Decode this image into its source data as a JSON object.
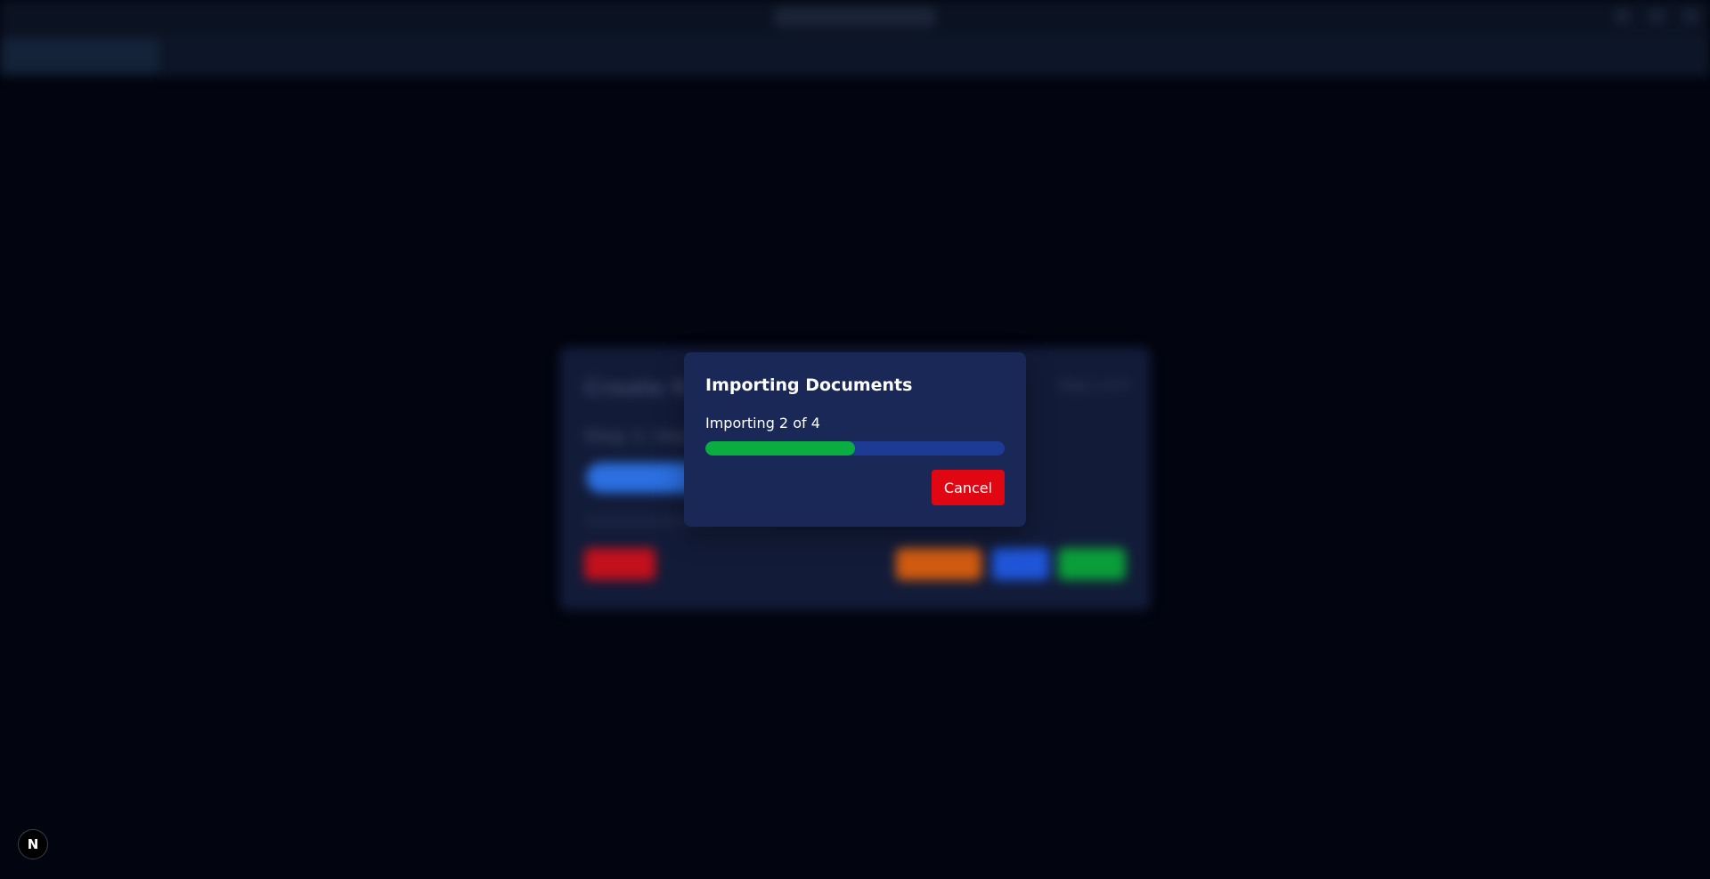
{
  "background": {
    "topbar": {
      "title": ""
    },
    "subbar": {
      "active_tab": ""
    },
    "dialog": {
      "title": "Create Re",
      "step_label": "Step 1 of 4",
      "subtitle": "Step 1: Impo"
    }
  },
  "modal": {
    "title": "Importing Documents",
    "status": "Importing 2 of 4",
    "progress": {
      "current": 2,
      "total": 4,
      "fraction": 0.5
    },
    "cancel_label": "Cancel"
  },
  "corner_badge": {
    "letter": "N"
  },
  "colors": {
    "modal_bg": "#1a2857",
    "progress_track": "#1d3b94",
    "progress_fill": "#0aae40",
    "cancel": "#e00712"
  }
}
